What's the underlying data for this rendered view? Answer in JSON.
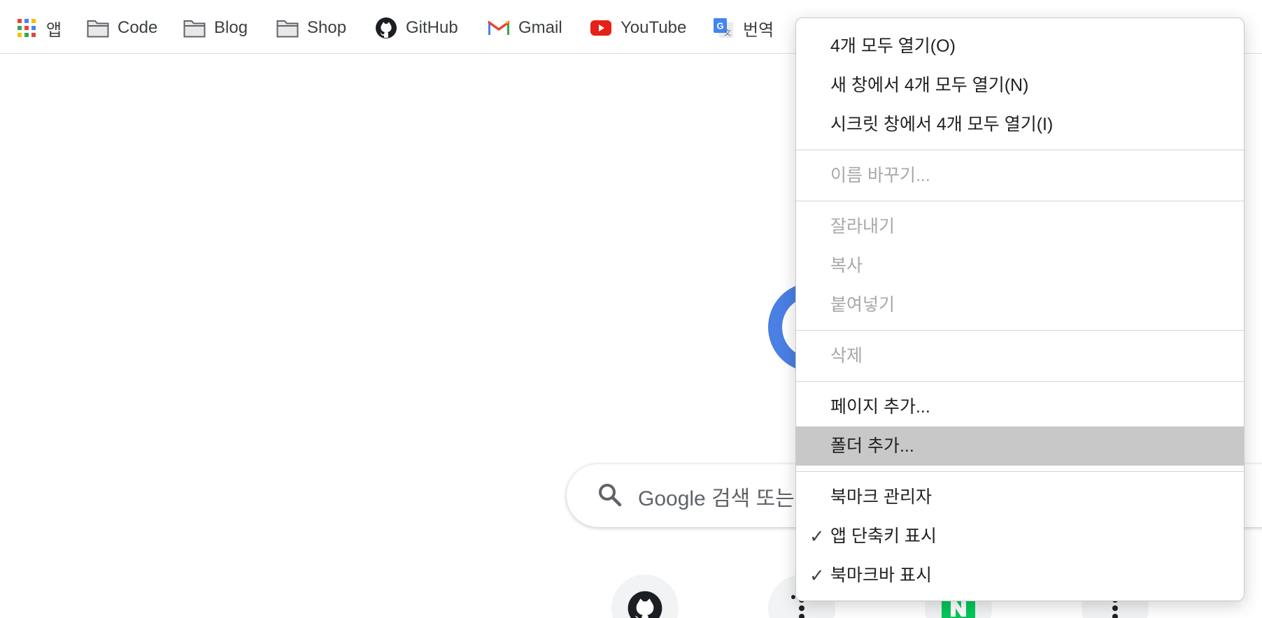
{
  "bookmarks_bar": {
    "items": [
      {
        "label": "앱",
        "icon": "apps-grid-icon"
      },
      {
        "label": "Code",
        "icon": "folder-icon"
      },
      {
        "label": "Blog",
        "icon": "folder-icon"
      },
      {
        "label": "Shop",
        "icon": "folder-icon"
      },
      {
        "label": "GitHub",
        "icon": "github-icon"
      },
      {
        "label": "Gmail",
        "icon": "gmail-icon"
      },
      {
        "label": "YouTube",
        "icon": "youtube-icon"
      },
      {
        "label": "번역",
        "icon": "google-translate-icon"
      }
    ]
  },
  "search": {
    "placeholder": "Google 검색 또는"
  },
  "shortcuts": [
    {
      "icon": "github-icon"
    },
    {
      "icon": "dots-icon"
    },
    {
      "icon": "naver-icon"
    },
    {
      "icon": "dots-icon"
    }
  ],
  "context_menu": {
    "groups": [
      [
        {
          "label": "4개 모두 열기(O)",
          "enabled": true
        },
        {
          "label": "새 창에서 4개 모두 열기(N)",
          "enabled": true
        },
        {
          "label": "시크릿 창에서 4개 모두 열기(I)",
          "enabled": true
        }
      ],
      [
        {
          "label": "이름 바꾸기...",
          "enabled": false
        }
      ],
      [
        {
          "label": "잘라내기",
          "enabled": false
        },
        {
          "label": "복사",
          "enabled": false
        },
        {
          "label": "붙여넣기",
          "enabled": false
        }
      ],
      [
        {
          "label": "삭제",
          "enabled": false
        }
      ],
      [
        {
          "label": "페이지 추가...",
          "enabled": true
        },
        {
          "label": "폴더 추가...",
          "enabled": true,
          "highlighted": true
        }
      ],
      [
        {
          "label": "북마크 관리자",
          "enabled": true
        },
        {
          "label": "앱 단축키 표시",
          "enabled": true,
          "checked": true
        },
        {
          "label": "북마크바 표시",
          "enabled": true,
          "checked": true
        }
      ]
    ],
    "check_glyph": "✓"
  },
  "colors": {
    "accent_blue": "#4a7fe3",
    "menu_highlight": "#c8c8c8",
    "disabled_text": "#a8a8a8",
    "youtube_red": "#e62117",
    "naver_green": "#03c75a"
  }
}
